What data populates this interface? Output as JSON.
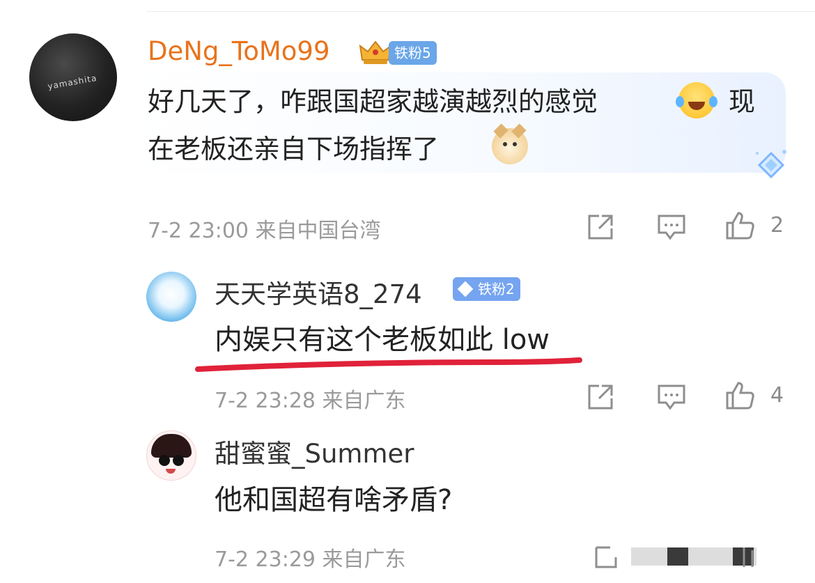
{
  "comments": [
    {
      "username": "DeNg_ToMo99",
      "avatar_text": "yamashita",
      "fan_badge": "铁粉5",
      "text_line1": "好几天了，咋跟国超家越演越烈的感觉",
      "text_line1_tail": "现",
      "text_line2": "在老板还亲自下场指挥了",
      "meta": "7-2 23:00 来自中国台湾",
      "likes": "2",
      "emojis": [
        "laugh-cry-emoji",
        "doge-emoji"
      ]
    },
    {
      "username": "天天学英语8_274",
      "fan_badge": "铁粉2",
      "text": "内娱只有这个老板如此 low",
      "meta": "7-2 23:28 来自广东",
      "likes": "4"
    },
    {
      "username": "甜蜜蜜_Summer",
      "text": "他和国超有啥矛盾?",
      "meta": "7-2 23:29 来自广东"
    }
  ],
  "icons": [
    "share-icon",
    "comment-icon",
    "like-icon"
  ],
  "colors": {
    "username_highlight": "#e8731c",
    "badge_blue": "#6aa6e8",
    "meta_gray": "#9a9a9a",
    "underline_red": "#e0223a"
  }
}
